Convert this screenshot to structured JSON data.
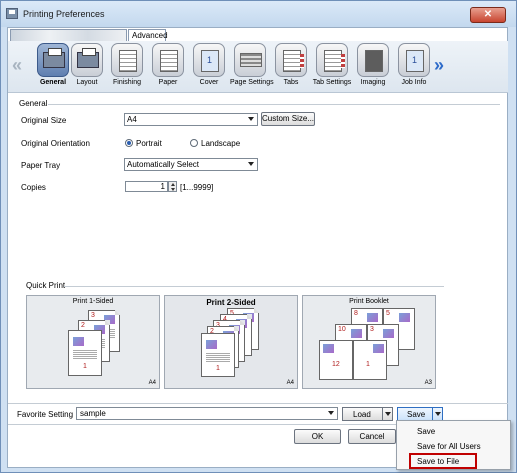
{
  "window": {
    "title": "Printing Preferences",
    "close_glyph": "✕"
  },
  "tabs": [
    {
      "label": ""
    },
    {
      "label": "Advanced"
    }
  ],
  "iconbar": {
    "left_arrow": "«",
    "right_arrow": "»",
    "items": [
      {
        "label": "General",
        "icon": "printer-icon"
      },
      {
        "label": "Layout",
        "icon": "layout-icon"
      },
      {
        "label": "Finishing",
        "icon": "finishing-icon"
      },
      {
        "label": "Paper",
        "icon": "paper-icon"
      },
      {
        "label": "Cover",
        "icon": "cover-icon"
      },
      {
        "label": "Page Settings",
        "icon": "page-settings-icon"
      },
      {
        "label": "Tabs",
        "icon": "tabs-icon"
      },
      {
        "label": "Tab Settings",
        "icon": "tab-settings-icon"
      },
      {
        "label": "Imaging",
        "icon": "imaging-icon"
      },
      {
        "label": "Job Info",
        "icon": "job-info-icon"
      }
    ]
  },
  "general": {
    "section": "General",
    "original_size_label": "Original Size",
    "original_size_value": "A4",
    "custom_size_button": "Custom Size...",
    "orientation_label": "Original Orientation",
    "portrait": "Portrait",
    "landscape": "Landscape",
    "paper_tray_label": "Paper Tray",
    "paper_tray_value": "Automatically Select",
    "copies_label": "Copies",
    "copies_value": "1",
    "copies_range": "[1...9999]"
  },
  "quick_print": {
    "section": "Quick Print",
    "cards": [
      {
        "title": "Print 1-Sided",
        "size": "A4",
        "pages": [
          "3",
          "2",
          "1"
        ]
      },
      {
        "title": "Print 2-Sided",
        "size": "A4",
        "pages": [
          "5",
          "4",
          "3",
          "2",
          "1"
        ]
      },
      {
        "title": "Print Booklet",
        "size": "A3",
        "pages": [
          "8",
          "5",
          "10",
          "3",
          "12",
          "1"
        ]
      }
    ]
  },
  "favorite": {
    "label": "Favorite Setting",
    "value": "sample",
    "load_button": "Load",
    "save_button": "Save"
  },
  "dialog_buttons": {
    "ok": "OK",
    "cancel": "Cancel"
  },
  "save_menu": {
    "items": [
      "Save",
      "Save for All Users",
      "Save to File"
    ],
    "highlight_color": "#c00000"
  }
}
